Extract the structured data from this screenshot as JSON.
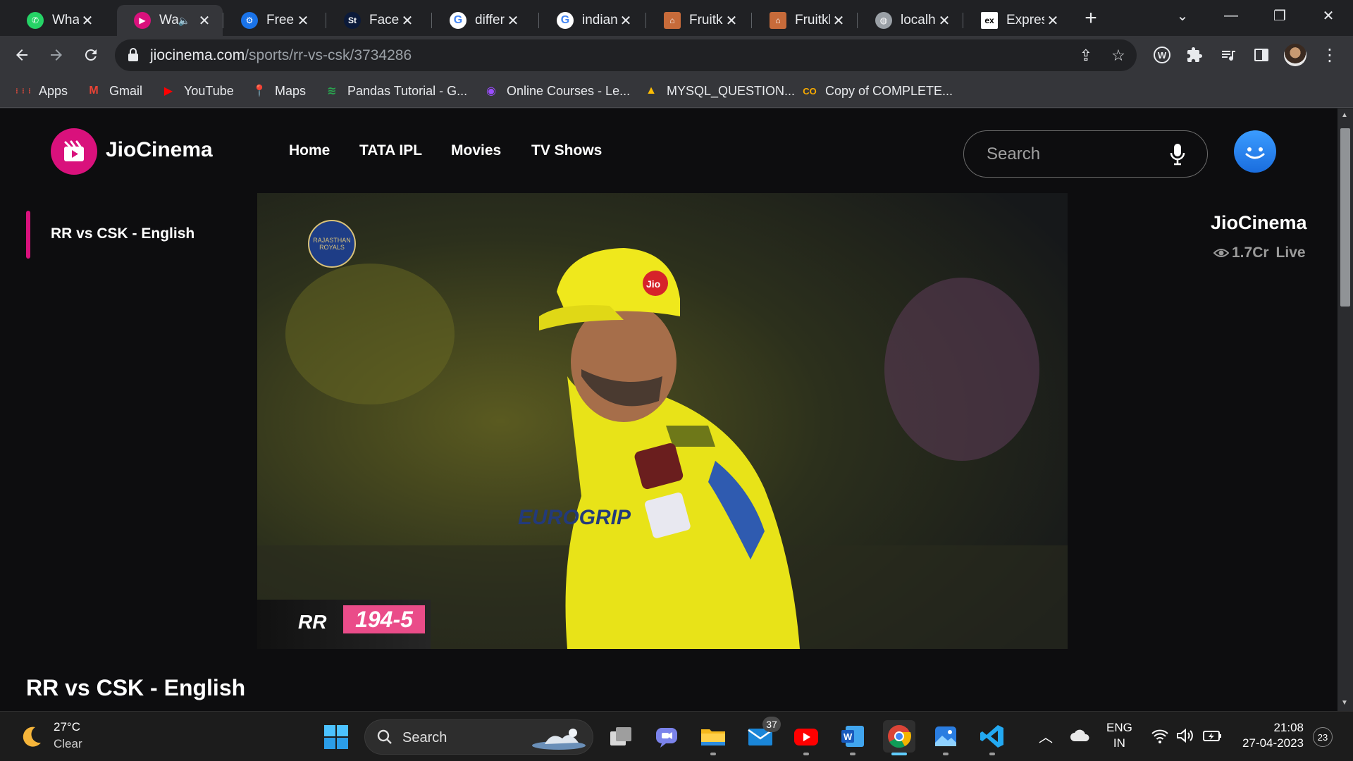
{
  "browser": {
    "tabs": [
      {
        "label": "WhatsA",
        "icon": "whatsapp-icon",
        "color": "#25d366"
      },
      {
        "label": "Wa",
        "icon": "jiocinema-icon",
        "color": "#d9117c",
        "active": true,
        "muted_icon": "speaker-icon"
      },
      {
        "label": "Free Ic",
        "icon": "gear-icon",
        "color": "#1a73e8"
      },
      {
        "label": "Faceles",
        "icon": "st-icon",
        "color": "#0b1a3a"
      },
      {
        "label": "differe",
        "icon": "google-icon",
        "color": "#ffffff"
      },
      {
        "label": "indian",
        "icon": "google-icon",
        "color": "#ffffff"
      },
      {
        "label": "Fruitkh",
        "icon": "basket-icon",
        "color": "#c76b3a"
      },
      {
        "label": "Fruitkh",
        "icon": "basket-icon",
        "color": "#c76b3a"
      },
      {
        "label": "localho",
        "icon": "globe-icon",
        "color": "#9aa0a6"
      },
      {
        "label": "Expres",
        "icon": "ex-icon",
        "color": "#ffffff"
      }
    ],
    "url_host": "jiocinema.com",
    "url_path": "/sports/rr-vs-csk/3734286",
    "bookmarks": [
      {
        "label": "Apps",
        "icon": "apps-grid-icon"
      },
      {
        "label": "Gmail",
        "icon": "gmail-icon"
      },
      {
        "label": "YouTube",
        "icon": "youtube-icon"
      },
      {
        "label": "Maps",
        "icon": "maps-icon"
      },
      {
        "label": "Pandas Tutorial - G...",
        "icon": "pandas-icon"
      },
      {
        "label": "Online Courses - Le...",
        "icon": "courses-icon"
      },
      {
        "label": "MYSQL_QUESTION...",
        "icon": "drive-icon"
      },
      {
        "label": "Copy of COMPLETE...",
        "icon": "colab-icon"
      }
    ]
  },
  "site": {
    "brand": "JioCinema",
    "brand_color": "#d9117c",
    "nav": [
      "Home",
      "TATA IPL",
      "Movies",
      "TV Shows"
    ],
    "search_placeholder": "Search",
    "side_item": "RR vs CSK - English",
    "channel": "JioCinema",
    "views": "1.7Cr",
    "live_label": "Live",
    "page_title": "RR vs CSK - English",
    "player": {
      "team_logo_text": "RAJASTHAN ROYALS",
      "score_team": "RR",
      "score": "194-5",
      "score_color": "#ea4c89"
    }
  },
  "taskbar": {
    "temp": "27°C",
    "weather": "Clear",
    "search_label": "Search",
    "mail_badge": "37",
    "lang_1": "ENG",
    "lang_2": "IN",
    "time": "21:08",
    "date": "27-04-2023",
    "notifications": "23"
  }
}
